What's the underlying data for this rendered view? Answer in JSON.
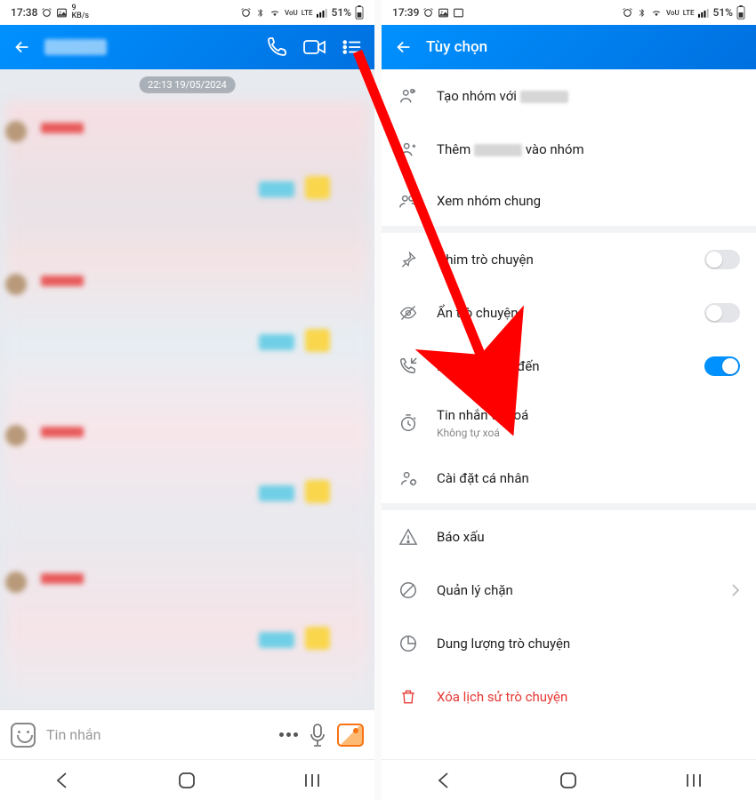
{
  "statusbar": {
    "left_time": "17:38",
    "right_time": "17:39",
    "kb_label": "9",
    "kb_unit": "KB/s",
    "network": "LTE",
    "volte": "VoU",
    "battery": "51%"
  },
  "chat": {
    "date_stamp": "22:13 19/05/2024",
    "input_placeholder": "Tin nhắn"
  },
  "options": {
    "header": "Tùy chọn",
    "items": [
      {
        "key": "create_group",
        "label_prefix": "Tạo nhóm với ",
        "label": "",
        "has_name": true
      },
      {
        "key": "add_to_group",
        "label_prefix": "Thêm ",
        "label_suffix": " vào nhóm",
        "has_name": true
      },
      {
        "key": "common_groups",
        "label": "Xem nhóm chung",
        "section_end": true
      },
      {
        "key": "pin_chat",
        "label": "Ghim trò chuyện",
        "toggle": "off"
      },
      {
        "key": "hide_chat",
        "label": "Ẩn trò chuyện",
        "toggle": "off"
      },
      {
        "key": "incoming_call",
        "label": "Báo cuộc gọi đến",
        "toggle": "on"
      },
      {
        "key": "auto_delete",
        "label": "Tin nhắn tự xoá",
        "sub": "Không tự xoá"
      },
      {
        "key": "personal_settings",
        "label": "Cài đặt cá nhân",
        "section_end": true
      },
      {
        "key": "report",
        "label": "Báo xấu"
      },
      {
        "key": "block_manage",
        "label": "Quản lý chặn",
        "chevron": true
      },
      {
        "key": "storage",
        "label": "Dung lượng trò chuyện"
      },
      {
        "key": "delete_history",
        "label": "Xóa lịch sử trò chuyện",
        "danger": true
      }
    ]
  }
}
